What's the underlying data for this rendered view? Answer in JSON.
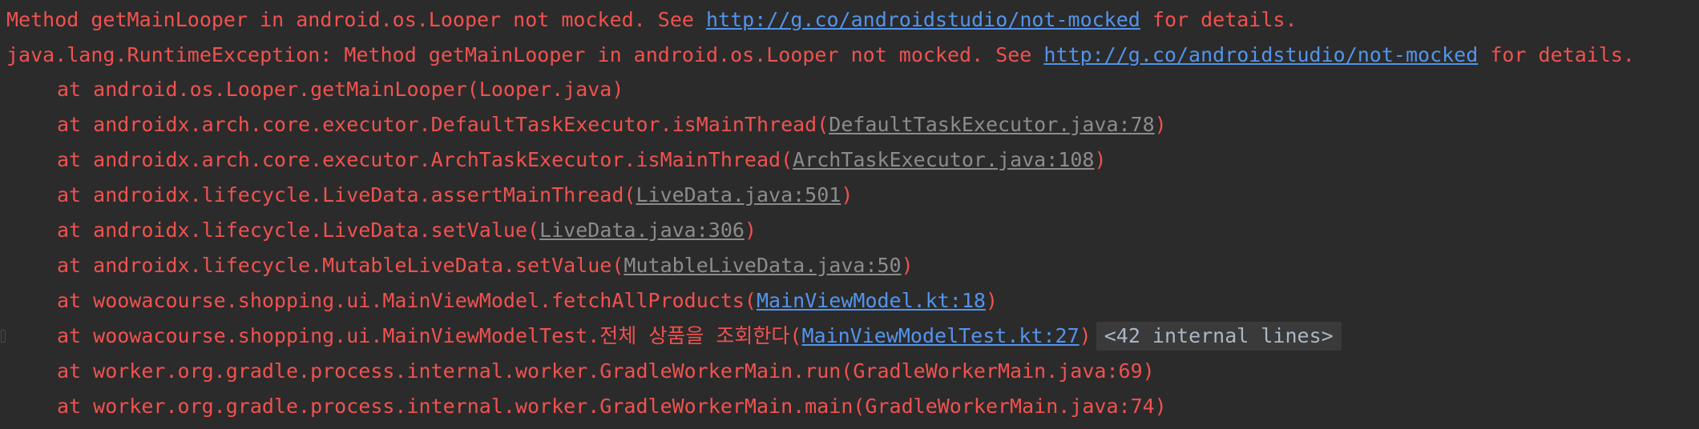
{
  "header": {
    "prefix": "Method getMainLooper in android.os.Looper not mocked. See ",
    "link": "http://g.co/androidstudio/not-mocked",
    "suffix": " for details."
  },
  "exception": {
    "prefix": "java.lang.RuntimeException: Method getMainLooper in android.os.Looper not mocked. See ",
    "link": "http://g.co/androidstudio/not-mocked",
    "suffix": " for details."
  },
  "frames": [
    {
      "pre": "at android.os.Looper.getMainLooper(Looper.java)",
      "link": "",
      "post": ""
    },
    {
      "pre": "at androidx.arch.core.executor.DefaultTaskExecutor.isMainThread(",
      "link": "DefaultTaskExecutor.java:78",
      "post": ")"
    },
    {
      "pre": "at androidx.arch.core.executor.ArchTaskExecutor.isMainThread(",
      "link": "ArchTaskExecutor.java:108",
      "post": ")"
    },
    {
      "pre": "at androidx.lifecycle.LiveData.assertMainThread(",
      "link": "LiveData.java:501",
      "post": ")"
    },
    {
      "pre": "at androidx.lifecycle.LiveData.setValue(",
      "link": "LiveData.java:306",
      "post": ")"
    },
    {
      "pre": "at androidx.lifecycle.MutableLiveData.setValue(",
      "link": "MutableLiveData.java:50",
      "post": ")"
    },
    {
      "pre": "at woowacourse.shopping.ui.MainViewModel.fetchAllProducts(",
      "link": "MainViewModel.kt:18",
      "post": ")"
    },
    {
      "pre": "at woowacourse.shopping.ui.MainViewModelTest.전체 상품을 조회한다(",
      "link": "MainViewModelTest.kt:27",
      "post": ")",
      "fold": "<42 internal lines>"
    },
    {
      "pre": "at worker.org.gradle.process.internal.worker.GradleWorkerMain.run(GradleWorkerMain.java:69)",
      "link": "",
      "post": ""
    },
    {
      "pre": "at worker.org.gradle.process.internal.worker.GradleWorkerMain.main(GradleWorkerMain.java:74)",
      "link": "",
      "post": ""
    }
  ]
}
